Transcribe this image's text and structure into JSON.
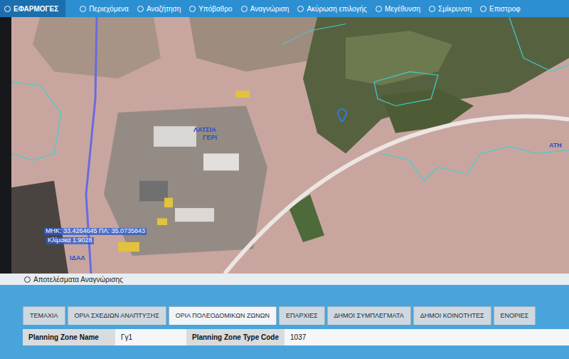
{
  "toolbar": {
    "apps": "ΕΦΑΡΜΟΓΕΣ",
    "items": [
      {
        "label": "Περιεχόμενα"
      },
      {
        "label": "Αναζήτηση"
      },
      {
        "label": "Υπόβαθρο"
      },
      {
        "label": "Αναγνώριση"
      },
      {
        "label": "Ακύρωση επιλογής"
      },
      {
        "label": "Μεγέθυνση"
      },
      {
        "label": "Σμίκρυνση"
      },
      {
        "label": "Επιστροφ"
      }
    ]
  },
  "map": {
    "labels": [
      {
        "text": "ΛΑΤΣΙΑ",
        "kind": "place"
      },
      {
        "text": "ΓΕΡΙ",
        "kind": "place"
      },
      {
        "text": "ΜΗΚ: 33.4264645 ΠΛ: 35.0735843",
        "kind": "coords"
      },
      {
        "text": "Κλίμακα 1:9028",
        "kind": "coords"
      },
      {
        "text": "ΙΔΑΛ",
        "kind": "place"
      },
      {
        "text": "ΑΤΗ",
        "kind": "place"
      }
    ]
  },
  "results": {
    "title": "Αποτελέσματα Αναγνώρισης",
    "tabs": [
      {
        "label": "ΤΕΜΑΧΙΑ",
        "selected": false
      },
      {
        "label": "ΟΡΙΑ ΣΧΕΔΙΩΝ ΑΝΑΠΤΥΞΗΣ",
        "selected": false
      },
      {
        "label": "ΟΡΙΑ ΠΟΛΕΟΔΟΜΙΚΩΝ ΖΩΝΩΝ",
        "selected": true
      },
      {
        "label": "ΕΠΑΡΧΙΕΣ",
        "selected": false
      },
      {
        "label": "ΔΗΜΟΙ ΣΥΜΠΛΕΓΜΑΤΑ",
        "selected": false
      },
      {
        "label": "ΔΗΜΟΙ ΚΟΙΝΟΤΗΤΕΣ",
        "selected": false
      },
      {
        "label": "ΕΝΟΡΙΕΣ",
        "selected": false
      }
    ],
    "fields": [
      {
        "label": "Planning Zone Name",
        "value": "Γγ1"
      },
      {
        "label": "Planning Zone Type Code",
        "value": "1037"
      }
    ]
  }
}
